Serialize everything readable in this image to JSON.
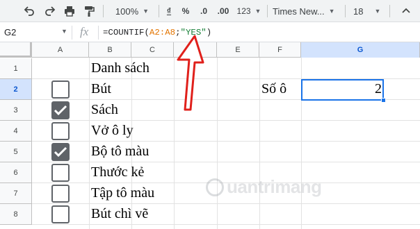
{
  "toolbar": {
    "zoom": "100%",
    "currency": "₫",
    "percent": "%",
    "decrease_decimal": ".0",
    "increase_decimal": ".00",
    "more_formats": "123",
    "font": "Times New...",
    "font_size": "18"
  },
  "formula_bar": {
    "cell_ref": "G2",
    "fx": "fx",
    "formula_start": "=COUNTIF(",
    "formula_range": "A2:A8",
    "formula_sep": ";",
    "formula_criteria": "\"YES\"",
    "formula_end": ")"
  },
  "columns": [
    "A",
    "B",
    "C",
    "D",
    "E",
    "F",
    "G"
  ],
  "rows": [
    "1",
    "2",
    "3",
    "4",
    "5",
    "6",
    "7",
    "8"
  ],
  "cells": {
    "B1": "Danh sách",
    "B2": "Bút",
    "B3": "Sách",
    "B4": "Vở ô ly",
    "B5": "Bộ tô màu",
    "B6": "Thước kẻ",
    "B7": "Tập tô màu",
    "B8": "Bút chì vẽ",
    "F2": "Số ô",
    "G2": "2"
  },
  "checkboxes": [
    false,
    true,
    false,
    true,
    false,
    false,
    false
  ],
  "watermark": "uantrimang",
  "colors": {
    "selection": "#1a73e8",
    "arrow": "#e0201b",
    "formula_range": "#e37400",
    "formula_string": "#188038"
  }
}
